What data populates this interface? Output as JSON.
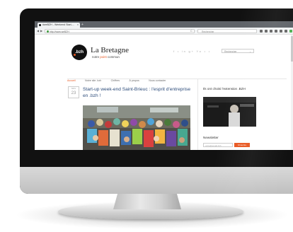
{
  "browser": {
    "tab_title": "#weBZH - Weekend Start-...",
    "tab_close": "×",
    "new_tab": "+",
    "url": "http://www.weBZH",
    "search_placeholder": "Rechercher",
    "back": "◀",
    "forward": "▶",
    "reload": "C"
  },
  "site": {
    "logo_text": ".bzh",
    "title": "La Bretagne",
    "tagline_prefix": "notre ",
    "tagline_highlight": "point",
    "tagline_suffix": " commun",
    "social_icons": "f  •  in  g+  Yo  •  •",
    "select_value": "Rechercher",
    "select_caret": "⌄"
  },
  "menu": {
    "items": [
      "Accueil",
      "Notre site .bzh",
      "Chiffres",
      "À propos",
      "Nous contacter"
    ]
  },
  "post": {
    "month": "NOV",
    "day": "23",
    "title": "Start-up week-end Saint-Brieuc : l'esprit d'entreprise en .bzh !"
  },
  "sidebar": {
    "widget_title": "Ils ont choisi l'extension .BZH",
    "newsletter_title": "Newsletter",
    "newsletter_placeholder": "votre@email.bzh",
    "newsletter_button": "S'inscrire"
  },
  "colors": {
    "accent": "#e8561f",
    "link": "#2d4c7a"
  }
}
